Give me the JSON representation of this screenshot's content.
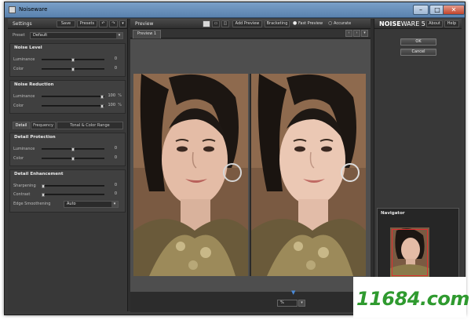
{
  "window": {
    "title": "Noiseware",
    "controls": [
      "–",
      "□",
      "✕"
    ]
  },
  "settings": {
    "header": "Settings",
    "save_label": "Save",
    "presets_label": "Presets",
    "undo_icon": "undo-icon",
    "redo_icon": "redo-icon",
    "preset_label": "Preset",
    "preset_value": "Default",
    "noise_level": {
      "title": "Noise Level",
      "luminance_label": "Luminance",
      "luminance_value": "0",
      "luminance_level": 0.5,
      "color_label": "Color",
      "color_value": "0",
      "color_level": 0.5
    },
    "noise_reduction": {
      "title": "Noise Reduction",
      "luminance_label": "Luminance",
      "luminance_value": "100",
      "luminance_unit": "%",
      "luminance_level": 1.0,
      "color_label": "Color",
      "color_value": "100",
      "color_unit": "%",
      "color_level": 1.0
    },
    "tabs": [
      "Detail",
      "Frequency",
      "Tonal & Color Range"
    ],
    "detail_protection": {
      "title": "Detail Protection",
      "luminance_label": "Luminance",
      "luminance_value": "0",
      "luminance_level": 0.5,
      "color_label": "Color",
      "color_value": "0",
      "color_level": 0.5
    },
    "detail_enhancement": {
      "title": "Detail Enhancement",
      "sharpening_label": "Sharpening",
      "sharpening_value": "0",
      "sharpening_level": 0.0,
      "contrast_label": "Contrast",
      "contrast_value": "0",
      "contrast_level": 0.0,
      "edge_label": "Edge Smoothening",
      "edge_value": "Auto"
    }
  },
  "preview": {
    "header": "Preview",
    "add_preview_label": "Add Preview",
    "bracketing_label": "Bracketing",
    "fast_preview_label": "Fast Preview",
    "accurate_label": "Accurate",
    "tab_label": "Preview 1",
    "zoom_value": "%"
  },
  "right": {
    "brand_prefix": "NOISE",
    "brand_suffix": "WARE 5",
    "about_label": "About",
    "help_label": "Help",
    "ok_label": "OK",
    "cancel_label": "Cancel",
    "navigator_label": "Navigator"
  },
  "watermark": {
    "text": "11684.com"
  },
  "colors": {
    "window_bg": "#2e2e2e",
    "panel_bg": "#383838",
    "titlebar": "#6a90bb",
    "watermark_green": "#2f9a2f"
  }
}
